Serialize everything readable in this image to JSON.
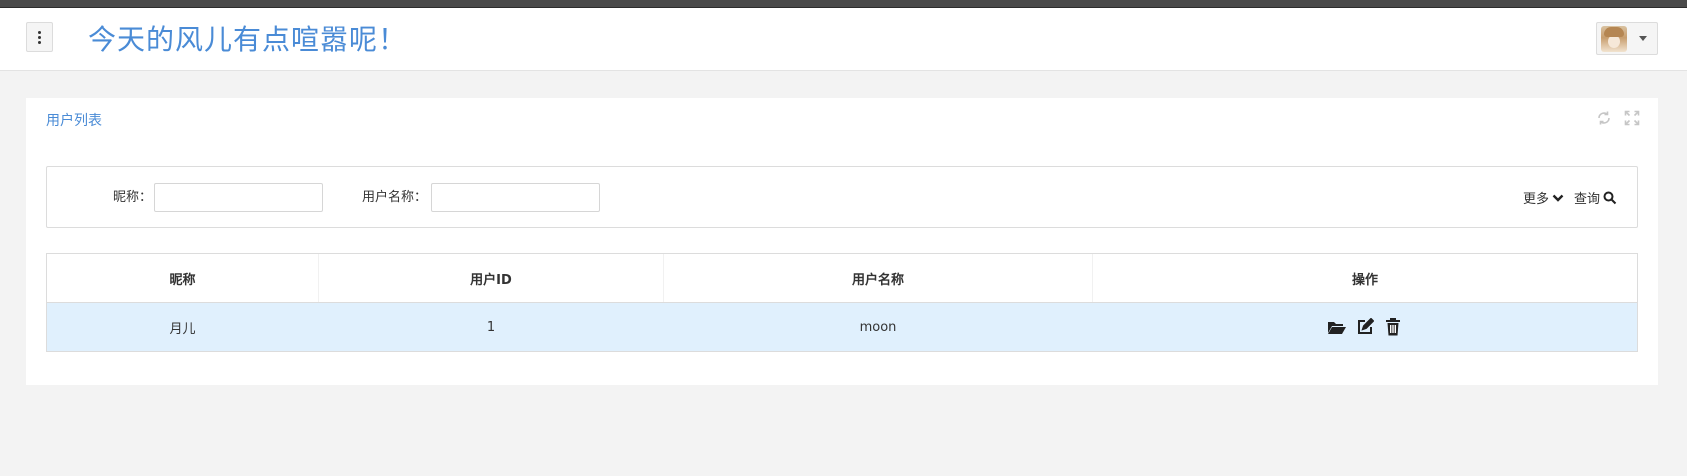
{
  "header": {
    "title": "今天的风儿有点喧嚣呢！",
    "menu_icon": "vertical-ellipsis-icon",
    "avatar_icon": "user-avatar",
    "caret_icon": "caret-down-icon"
  },
  "panel": {
    "title": "用户列表",
    "tools": [
      "refresh-icon",
      "fullscreen-icon"
    ]
  },
  "search": {
    "nickname_label": "昵称：",
    "nickname_value": "",
    "username_label": "用户名称：",
    "username_value": "",
    "more_label": "更多",
    "query_label": "查询"
  },
  "table": {
    "columns": [
      "昵称",
      "用户ID",
      "用户名称",
      "操作"
    ],
    "rows": [
      {
        "nickname": "月儿",
        "user_id": "1",
        "username": "moon",
        "actions": [
          "folder-open-icon",
          "edit-icon",
          "trash-icon"
        ]
      }
    ]
  },
  "colors": {
    "accent": "#4a8bd6",
    "selected_row": "#e0f0fd",
    "page_bg": "#f3f3f3"
  }
}
